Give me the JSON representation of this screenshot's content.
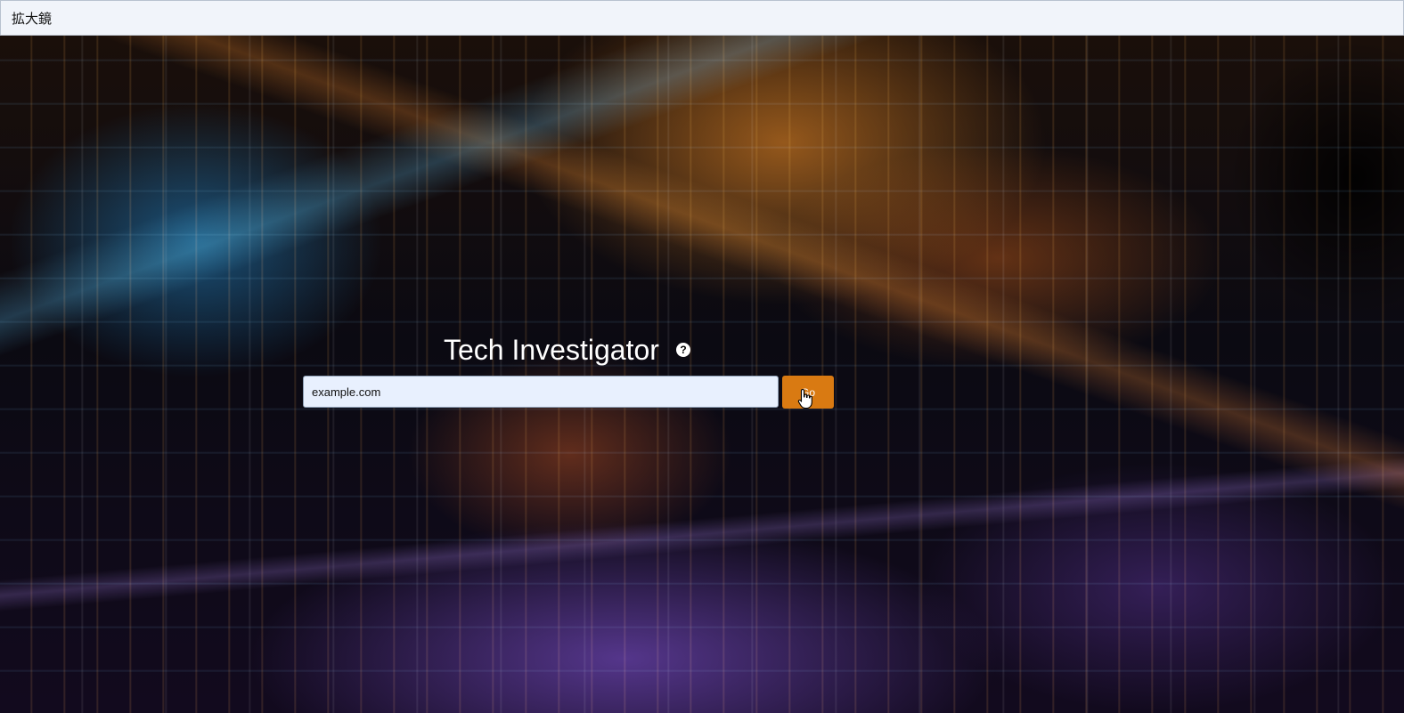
{
  "window": {
    "title": "拡大鏡"
  },
  "main": {
    "heading": "Tech Investigator",
    "help_icon_glyph": "?",
    "search": {
      "value": "example.com",
      "placeholder": ""
    },
    "go_button_label": "Go"
  },
  "icons": {
    "help": "question-circle-icon",
    "cursor": "hand-pointer-icon"
  },
  "colors": {
    "accent": "#d97a12",
    "input_background": "#e8f0fe",
    "heading_text": "#ffffff"
  }
}
